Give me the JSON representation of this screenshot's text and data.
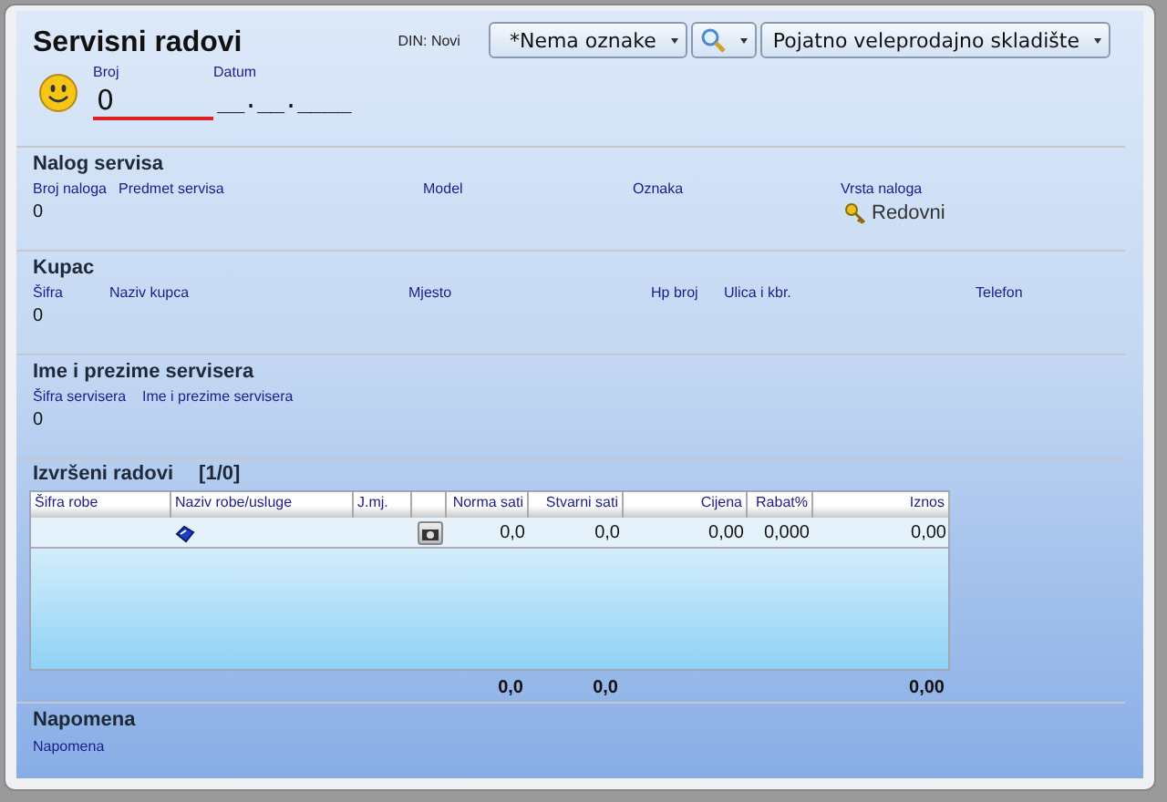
{
  "window": {
    "title": "Servisni radovi",
    "currency": "DIN: Novi"
  },
  "toolbar": {
    "tag_dropdown": "*Nema oznake",
    "warehouse_dropdown": "Pojatno veleprodajno skladište"
  },
  "document": {
    "number_label": "Broj",
    "number_value": "0",
    "date_label": "Datum",
    "date_value": "__.__.____"
  },
  "sections": [
    {
      "title": "Nalog servisa",
      "fields": [
        {
          "kind": "text",
          "label": "Broj naloga",
          "value": "0"
        },
        {
          "kind": "text",
          "label": "Predmet servisa"
        },
        {
          "kind": "text",
          "label": "Model"
        },
        {
          "kind": "text",
          "label": "Oznaka"
        },
        {
          "kind": "key",
          "label": "Vrsta naloga",
          "value": "Redovni"
        }
      ]
    },
    {
      "title": "Kupac",
      "fields": [
        {
          "kind": "text",
          "label": "Šifra",
          "value": "0"
        },
        {
          "kind": "text",
          "label": "Naziv kupca"
        },
        {
          "kind": "text",
          "label": "Mjesto"
        },
        {
          "kind": "text",
          "label": "Hp broj"
        },
        {
          "kind": "text",
          "label": "Ulica i kbr."
        },
        {
          "kind": "text",
          "label": "Telefon"
        }
      ]
    },
    {
      "title": "Ime i prezime servisera",
      "fields": [
        {
          "kind": "text",
          "label": "Šifra servisera",
          "value": "0"
        },
        {
          "kind": "text",
          "label": "Ime i prezime servisera"
        }
      ]
    }
  ],
  "work": {
    "title": "Izvršeni radovi",
    "count": "[1/0]",
    "columns": [
      {
        "label": "Šifra robe"
      },
      {
        "label": "Naziv robe/usluge"
      },
      {
        "label": "J.mj."
      },
      {
        "kind": "blank"
      },
      {
        "label": "Norma sati"
      },
      {
        "label": "Stvarni sati"
      },
      {
        "label": "Cijena"
      },
      {
        "label": "Rabat%"
      },
      {
        "label": "Iznos"
      }
    ],
    "rows": [
      {
        "cells": [
          {
            "kind": "empty"
          },
          {
            "kind": "edit-icon"
          },
          {
            "kind": "empty"
          },
          {
            "kind": "button"
          },
          {
            "kind": "text",
            "text": "0,0"
          },
          {
            "kind": "text",
            "text": "0,0"
          },
          {
            "kind": "text",
            "text": "0,00"
          },
          {
            "kind": "text",
            "text": "0,000"
          },
          {
            "kind": "text",
            "text": "0,00"
          }
        ]
      }
    ],
    "totals": [
      {
        "kind": "empty"
      },
      {
        "kind": "empty"
      },
      {
        "kind": "empty"
      },
      {
        "kind": "empty"
      },
      {
        "kind": "text",
        "text": "0,0"
      },
      {
        "kind": "text",
        "text": "0,0"
      },
      {
        "kind": "empty"
      },
      {
        "kind": "empty"
      },
      {
        "kind": "text",
        "text": "0,00"
      }
    ]
  },
  "note": {
    "title": "Napomena",
    "label": "Napomena"
  }
}
